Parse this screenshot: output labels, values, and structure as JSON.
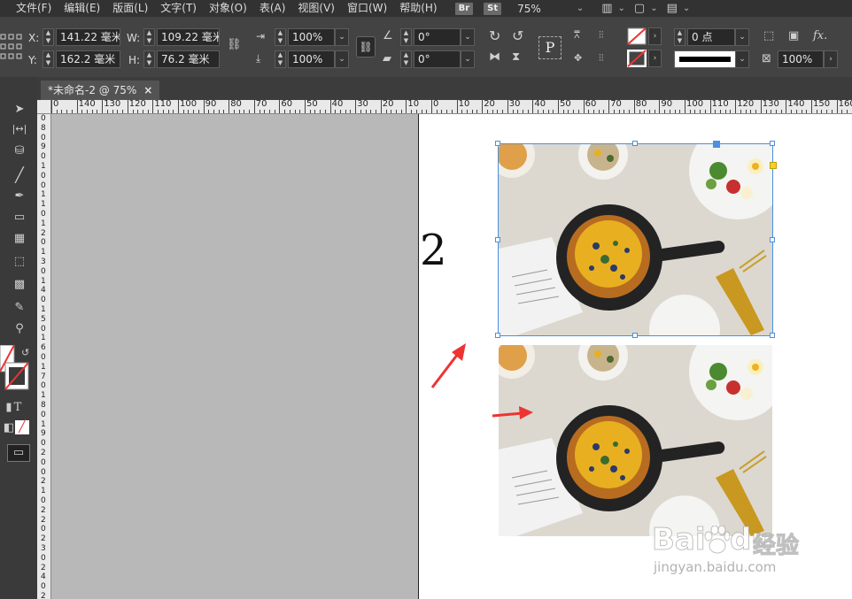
{
  "menubar": {
    "items": [
      "文件(F)",
      "编辑(E)",
      "版面(L)",
      "文字(T)",
      "对象(O)",
      "表(A)",
      "视图(V)",
      "窗口(W)",
      "帮助(H)"
    ],
    "bridge_badge": "Br",
    "stock_badge": "St",
    "zoom": "75%"
  },
  "control": {
    "x_label": "X:",
    "x_value": "141.22 毫米",
    "y_label": "Y:",
    "y_value": "162.2 毫米",
    "w_label": "W:",
    "w_value": "109.22 毫米",
    "h_label": "H:",
    "h_value": "76.2 毫米",
    "scale_x": "100%",
    "scale_y": "100%",
    "rotate": "0°",
    "shear": "0°",
    "stroke_weight": "0 点",
    "opacity": "100%"
  },
  "document": {
    "tab_title": "*未命名-2 @ 75%",
    "close_glyph": "×",
    "page_number": "2"
  },
  "rulers": {
    "top_labels": [
      "0",
      "140",
      "130",
      "120",
      "110",
      "100",
      "90",
      "80",
      "70",
      "60",
      "50",
      "40",
      "30",
      "20",
      "10",
      "0",
      "10",
      "20",
      "30",
      "40",
      "50",
      "60",
      "70",
      "80",
      "90",
      "100",
      "110",
      "120",
      "130",
      "140",
      "150",
      "160",
      "17"
    ],
    "left_labels": [
      "0",
      "8",
      "0",
      "9",
      "0",
      "1",
      "0",
      "0",
      "1",
      "1",
      "0",
      "1",
      "2",
      "0",
      "1",
      "3",
      "0",
      "1",
      "4",
      "0",
      "1",
      "5",
      "0",
      "1",
      "6",
      "0",
      "1",
      "7",
      "0",
      "1",
      "8",
      "0",
      "1",
      "9",
      "0",
      "2",
      "0",
      "0",
      "2",
      "1",
      "0",
      "2",
      "2",
      "0",
      "2",
      "3",
      "0",
      "2",
      "4",
      "0",
      "2"
    ]
  },
  "watermark": {
    "brand": "Bai",
    "brand2": "du",
    "suffix": "经验",
    "url": "jingyan.baidu.com"
  },
  "colors": {
    "selection": "#4a8fe0",
    "arrow": "#ee3333",
    "anchor_yellow": "#f6d21a"
  }
}
